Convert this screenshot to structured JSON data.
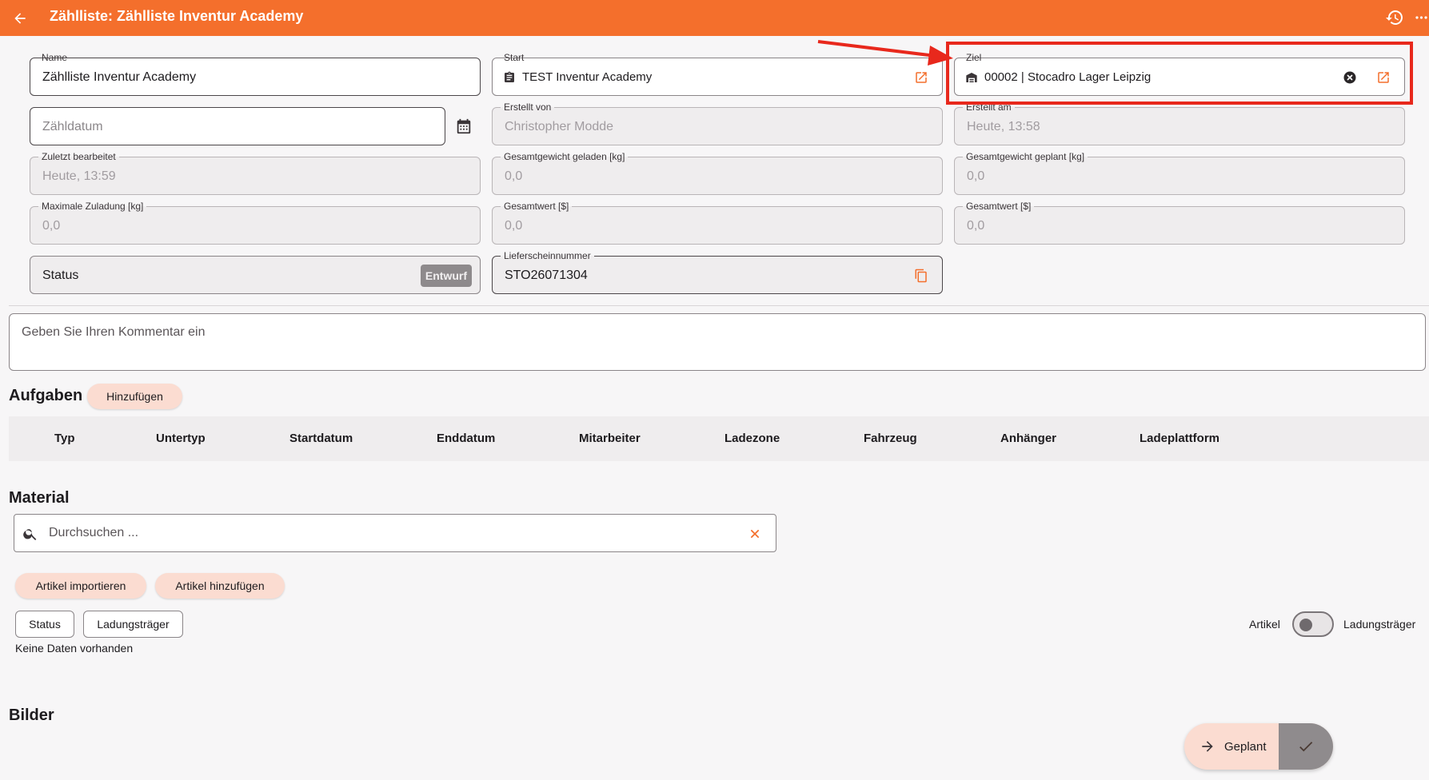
{
  "appbar": {
    "title": "Zählliste: Zählliste Inventur Academy"
  },
  "fields": {
    "name": {
      "label": "Name",
      "value": "Zählliste Inventur Academy"
    },
    "start": {
      "label": "Start",
      "value": "TEST Inventur Academy"
    },
    "ziel": {
      "label": "Ziel",
      "value": "00002 | Stocadro Lager Leipzig"
    },
    "zaehldatum": {
      "placeholder": "Zähldatum"
    },
    "erstellt_von": {
      "label": "Erstellt von",
      "value": "Christopher Modde"
    },
    "erstellt_am": {
      "label": "Erstellt am",
      "value": "Heute, 13:58"
    },
    "zuletzt": {
      "label": "Zuletzt bearbeitet",
      "value": "Heute, 13:59"
    },
    "gewicht_geladen": {
      "label": "Gesamtgewicht geladen [kg]",
      "value": "0,0"
    },
    "gewicht_geplant": {
      "label": "Gesamtgewicht geplant [kg]",
      "value": "0,0"
    },
    "max_zuladung": {
      "label": "Maximale Zuladung [kg]",
      "value": "0,0"
    },
    "gesamtwert1": {
      "label": "Gesamtwert [$]",
      "value": "0,0"
    },
    "gesamtwert2": {
      "label": "Gesamtwert [$]",
      "value": "0,0"
    },
    "status": {
      "label": "Status",
      "badge": "Entwurf"
    },
    "lieferschein": {
      "label": "Lieferscheinnummer",
      "value": "STO26071304"
    }
  },
  "comment": {
    "placeholder": "Geben Sie Ihren Kommentar ein"
  },
  "aufgaben": {
    "title": "Aufgaben",
    "add_label": "Hinzufügen",
    "columns": [
      "Typ",
      "Untertyp",
      "Startdatum",
      "Enddatum",
      "Mitarbeiter",
      "Ladezone",
      "Fahrzeug",
      "Anhänger",
      "Ladeplattform"
    ]
  },
  "material": {
    "title": "Material",
    "search_placeholder": "Durchsuchen ...",
    "import_label": "Artikel importieren",
    "add_label": "Artikel hinzufügen",
    "filter_status": "Status",
    "filter_ladungstraeger": "Ladungsträger",
    "empty": "Keine Daten vorhanden",
    "toggle_left": "Artikel",
    "toggle_right": "Ladungsträger"
  },
  "bilder": {
    "title": "Bilder"
  },
  "fab": {
    "label": "Geplant"
  },
  "colors": {
    "accent": "#f46f2c",
    "highlight": "#e8281c",
    "chip_bg": "#fbdcd1"
  }
}
